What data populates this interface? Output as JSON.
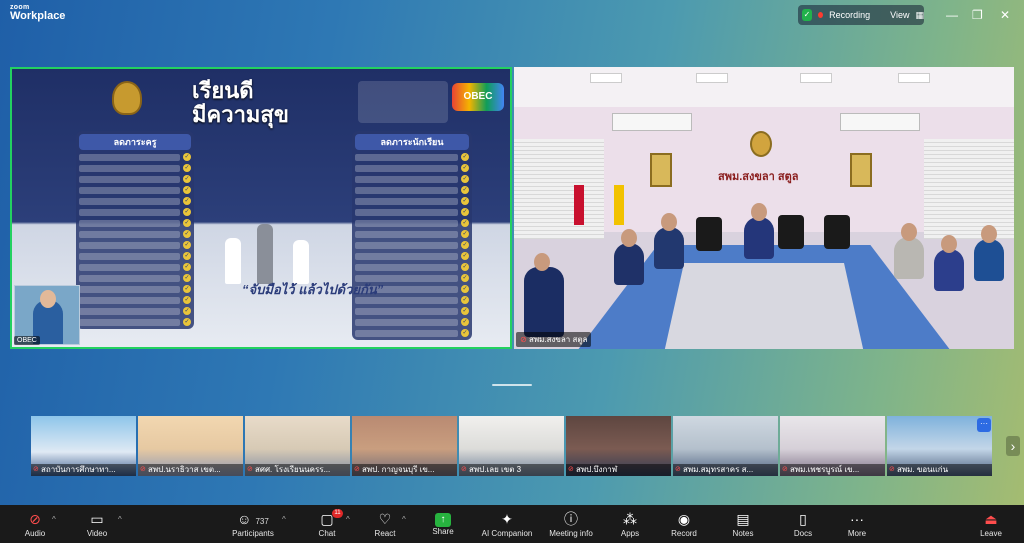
{
  "app": {
    "logo_line1": "zoom",
    "logo_line2": "Workplace"
  },
  "titlebar": {
    "recording_label": "Recording",
    "view_label": "View",
    "colors": {
      "recording_dot": "#ff3b30",
      "shield": "#21b24b"
    }
  },
  "share_tile": {
    "name": "OBEC",
    "slide_title_line1": "เรียนดี",
    "slide_title_line2": "มีความสุข",
    "left_panel_title": "ลดภาระครู",
    "right_panel_title": "ลดภาระนักเรียน",
    "slogan": "“จับมือไว้ แล้วไปด้วยกัน”",
    "obec_badge": "OBEC",
    "highlight_color": "#23d160"
  },
  "room_tile": {
    "name": "สพม.สงขลา สตูล",
    "sign": "สพม.สงขลา สตูล"
  },
  "thumbnails": [
    {
      "name": "สถาบันการศึกษาทา..."
    },
    {
      "name": "สพป.นราธิวาส เขต..."
    },
    {
      "name": "สศศ. โรงเรียนนครร..."
    },
    {
      "name": "สพป. กาญจนบุรี เข..."
    },
    {
      "name": "สพป.เลย เขต 3"
    },
    {
      "name": "สพป.บึงกาฬ"
    },
    {
      "name": "สพม.สมุทรสาคร ส..."
    },
    {
      "name": "สพม.เพชรบูรณ์ เข..."
    },
    {
      "name": "สพม. ขอนแก่น"
    }
  ],
  "toolbar": {
    "audio": "Audio",
    "video": "Video",
    "participants": "Participants",
    "participants_count": "737",
    "chat": "Chat",
    "chat_badge": "11",
    "react": "React",
    "share": "Share",
    "ai_companion": "AI Companion",
    "meeting_info": "Meeting info",
    "apps": "Apps",
    "record": "Record",
    "notes": "Notes",
    "docs": "Docs",
    "more": "More",
    "leave": "Leave"
  },
  "icons": [
    "shield-icon",
    "grid-icon",
    "minimize-icon",
    "restore-icon",
    "close-icon",
    "mic-muted-icon",
    "video-icon",
    "participants-icon",
    "chat-icon",
    "react-icon",
    "share-screen-icon",
    "ai-sparkle-icon",
    "info-icon",
    "apps-icon",
    "record-icon",
    "notes-icon",
    "docs-icon",
    "more-icon",
    "leave-icon",
    "chevron-right-icon",
    "ellipsis-icon"
  ]
}
